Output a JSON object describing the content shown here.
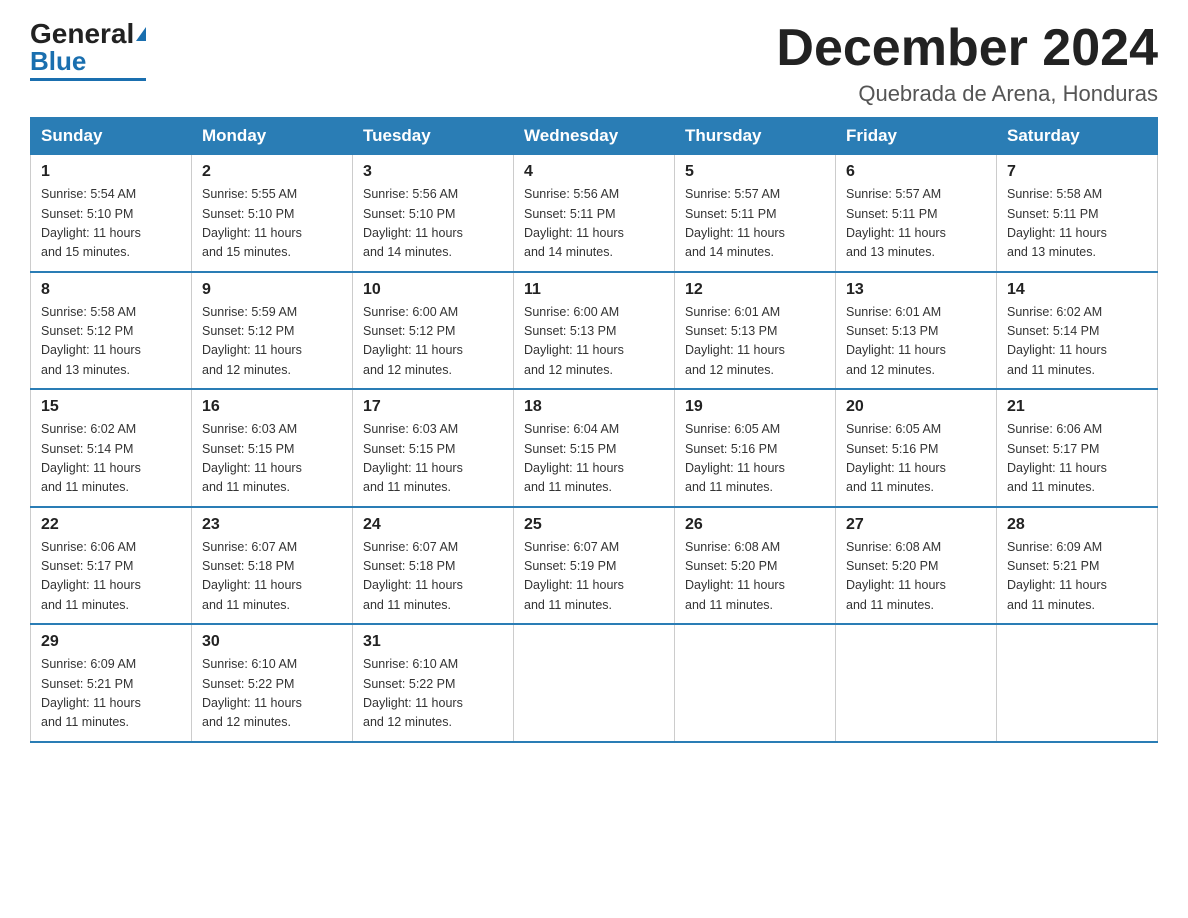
{
  "header": {
    "logo_general": "General",
    "logo_blue": "Blue",
    "month_title": "December 2024",
    "location": "Quebrada de Arena, Honduras"
  },
  "days_of_week": [
    "Sunday",
    "Monday",
    "Tuesday",
    "Wednesday",
    "Thursday",
    "Friday",
    "Saturday"
  ],
  "weeks": [
    [
      {
        "day": "1",
        "sunrise": "5:54 AM",
        "sunset": "5:10 PM",
        "daylight": "11 hours and 15 minutes."
      },
      {
        "day": "2",
        "sunrise": "5:55 AM",
        "sunset": "5:10 PM",
        "daylight": "11 hours and 15 minutes."
      },
      {
        "day": "3",
        "sunrise": "5:56 AM",
        "sunset": "5:10 PM",
        "daylight": "11 hours and 14 minutes."
      },
      {
        "day": "4",
        "sunrise": "5:56 AM",
        "sunset": "5:11 PM",
        "daylight": "11 hours and 14 minutes."
      },
      {
        "day": "5",
        "sunrise": "5:57 AM",
        "sunset": "5:11 PM",
        "daylight": "11 hours and 14 minutes."
      },
      {
        "day": "6",
        "sunrise": "5:57 AM",
        "sunset": "5:11 PM",
        "daylight": "11 hours and 13 minutes."
      },
      {
        "day": "7",
        "sunrise": "5:58 AM",
        "sunset": "5:11 PM",
        "daylight": "11 hours and 13 minutes."
      }
    ],
    [
      {
        "day": "8",
        "sunrise": "5:58 AM",
        "sunset": "5:12 PM",
        "daylight": "11 hours and 13 minutes."
      },
      {
        "day": "9",
        "sunrise": "5:59 AM",
        "sunset": "5:12 PM",
        "daylight": "11 hours and 12 minutes."
      },
      {
        "day": "10",
        "sunrise": "6:00 AM",
        "sunset": "5:12 PM",
        "daylight": "11 hours and 12 minutes."
      },
      {
        "day": "11",
        "sunrise": "6:00 AM",
        "sunset": "5:13 PM",
        "daylight": "11 hours and 12 minutes."
      },
      {
        "day": "12",
        "sunrise": "6:01 AM",
        "sunset": "5:13 PM",
        "daylight": "11 hours and 12 minutes."
      },
      {
        "day": "13",
        "sunrise": "6:01 AM",
        "sunset": "5:13 PM",
        "daylight": "11 hours and 12 minutes."
      },
      {
        "day": "14",
        "sunrise": "6:02 AM",
        "sunset": "5:14 PM",
        "daylight": "11 hours and 11 minutes."
      }
    ],
    [
      {
        "day": "15",
        "sunrise": "6:02 AM",
        "sunset": "5:14 PM",
        "daylight": "11 hours and 11 minutes."
      },
      {
        "day": "16",
        "sunrise": "6:03 AM",
        "sunset": "5:15 PM",
        "daylight": "11 hours and 11 minutes."
      },
      {
        "day": "17",
        "sunrise": "6:03 AM",
        "sunset": "5:15 PM",
        "daylight": "11 hours and 11 minutes."
      },
      {
        "day": "18",
        "sunrise": "6:04 AM",
        "sunset": "5:15 PM",
        "daylight": "11 hours and 11 minutes."
      },
      {
        "day": "19",
        "sunrise": "6:05 AM",
        "sunset": "5:16 PM",
        "daylight": "11 hours and 11 minutes."
      },
      {
        "day": "20",
        "sunrise": "6:05 AM",
        "sunset": "5:16 PM",
        "daylight": "11 hours and 11 minutes."
      },
      {
        "day": "21",
        "sunrise": "6:06 AM",
        "sunset": "5:17 PM",
        "daylight": "11 hours and 11 minutes."
      }
    ],
    [
      {
        "day": "22",
        "sunrise": "6:06 AM",
        "sunset": "5:17 PM",
        "daylight": "11 hours and 11 minutes."
      },
      {
        "day": "23",
        "sunrise": "6:07 AM",
        "sunset": "5:18 PM",
        "daylight": "11 hours and 11 minutes."
      },
      {
        "day": "24",
        "sunrise": "6:07 AM",
        "sunset": "5:18 PM",
        "daylight": "11 hours and 11 minutes."
      },
      {
        "day": "25",
        "sunrise": "6:07 AM",
        "sunset": "5:19 PM",
        "daylight": "11 hours and 11 minutes."
      },
      {
        "day": "26",
        "sunrise": "6:08 AM",
        "sunset": "5:20 PM",
        "daylight": "11 hours and 11 minutes."
      },
      {
        "day": "27",
        "sunrise": "6:08 AM",
        "sunset": "5:20 PM",
        "daylight": "11 hours and 11 minutes."
      },
      {
        "day": "28",
        "sunrise": "6:09 AM",
        "sunset": "5:21 PM",
        "daylight": "11 hours and 11 minutes."
      }
    ],
    [
      {
        "day": "29",
        "sunrise": "6:09 AM",
        "sunset": "5:21 PM",
        "daylight": "11 hours and 11 minutes."
      },
      {
        "day": "30",
        "sunrise": "6:10 AM",
        "sunset": "5:22 PM",
        "daylight": "11 hours and 12 minutes."
      },
      {
        "day": "31",
        "sunrise": "6:10 AM",
        "sunset": "5:22 PM",
        "daylight": "11 hours and 12 minutes."
      },
      null,
      null,
      null,
      null
    ]
  ],
  "labels": {
    "sunrise": "Sunrise:",
    "sunset": "Sunset:",
    "daylight": "Daylight:"
  }
}
